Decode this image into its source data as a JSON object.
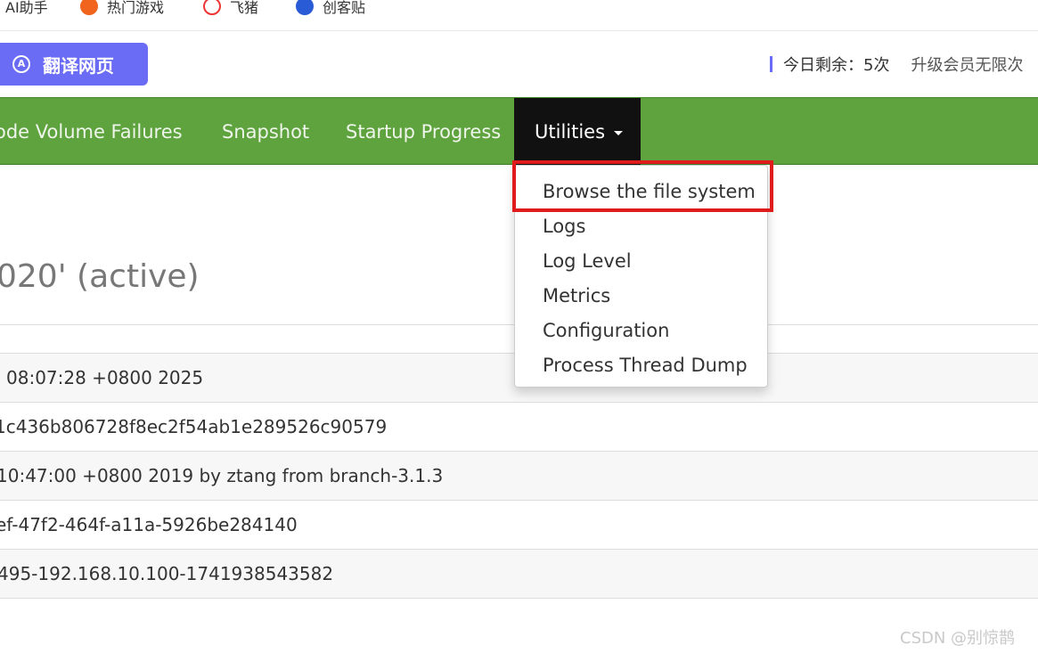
{
  "bookmarks": [
    {
      "label": "AI助手",
      "icon": "ai-assistant-icon"
    },
    {
      "label": "热门游戏",
      "icon": "game-icon"
    },
    {
      "label": "飞猪",
      "icon": "fliggy-icon"
    },
    {
      "label": "创客贴",
      "icon": "chuangkit-icon"
    }
  ],
  "translate": {
    "button_label": "翻译网页",
    "quota_label": "今日剩余：5次",
    "upgrade_label": "升级会员无限次",
    "accent_color": "#6a6cf6"
  },
  "navbar": {
    "color": "#5fa33e",
    "items": [
      {
        "label": "ode Volume Failures"
      },
      {
        "label": "Snapshot"
      },
      {
        "label": "Startup Progress"
      },
      {
        "label": "Utilities",
        "active": true
      }
    ]
  },
  "dropdown": {
    "items": [
      {
        "label": "Browse the file system",
        "highlighted": true
      },
      {
        "label": "Logs"
      },
      {
        "label": "Log Level"
      },
      {
        "label": "Metrics"
      },
      {
        "label": "Configuration"
      },
      {
        "label": "Process Thread Dump"
      }
    ],
    "highlight_color": "#e01b1b"
  },
  "page": {
    "title": "020' (active)"
  },
  "table": {
    "rows": [
      "08:07:28 +0800 2025",
      "1c436b806728f8ec2f54ab1e289526c90579",
      "10:47:00 +0800 2019 by ztang from branch-3.1.3",
      "ef-47f2-464f-a11a-5926be284140",
      "495-192.168.10.100-1741938543582"
    ]
  },
  "watermark": "CSDN @别惊鹊"
}
